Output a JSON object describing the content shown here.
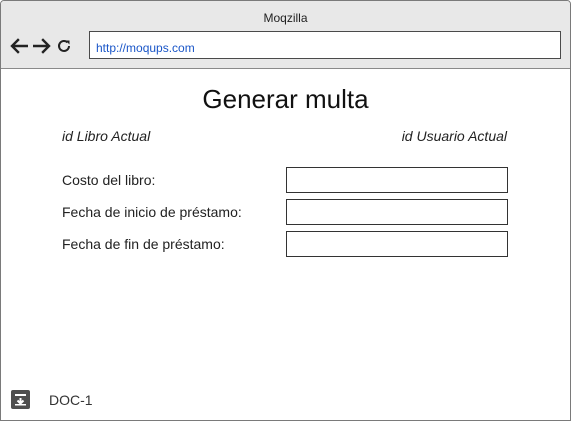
{
  "window": {
    "title": "Moqzilla"
  },
  "browser": {
    "url": "http://moqups.com",
    "icons": {
      "back": "arrow-left-icon",
      "forward": "arrow-right-icon",
      "reload": "reload-icon"
    }
  },
  "page": {
    "heading": "Generar multa",
    "book_id_label": "id Libro Actual",
    "user_id_label": "id Usuario Actual",
    "form": [
      {
        "label": "Costo del libro:",
        "value": ""
      },
      {
        "label": "Fecha de inicio de préstamo:",
        "value": ""
      },
      {
        "label": "Fecha de fin de préstamo:",
        "value": ""
      }
    ]
  },
  "footer": {
    "icon": "download-box-icon",
    "label": "DOC-1"
  },
  "colors": {
    "url": "#1a56c8",
    "chrome": "#e8e8e8",
    "border": "#333333"
  }
}
